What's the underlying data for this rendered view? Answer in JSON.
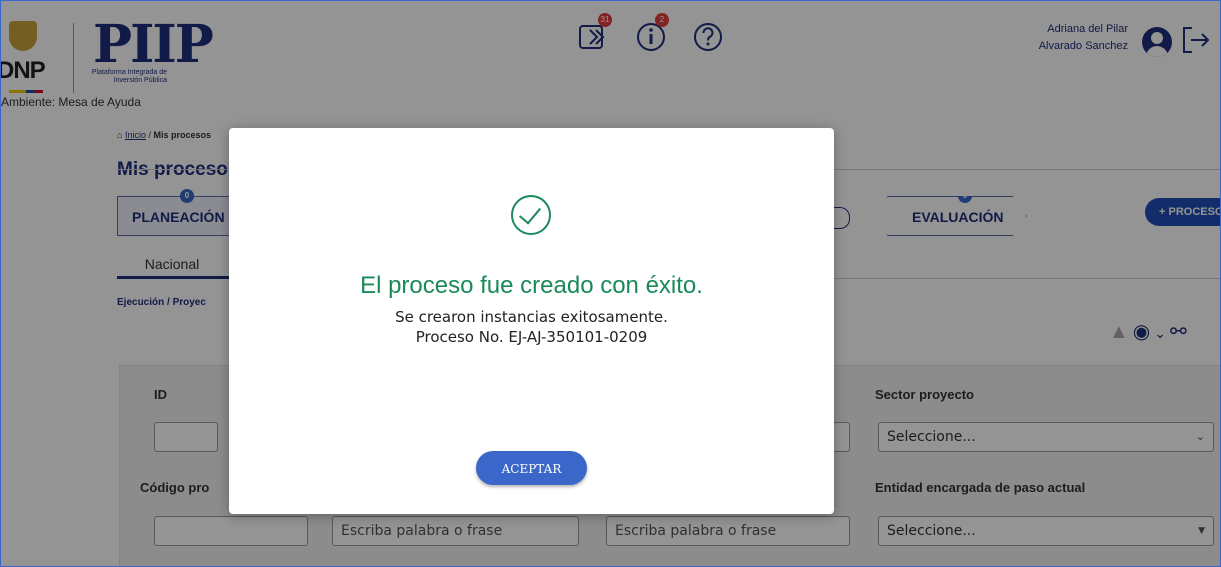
{
  "header": {
    "logo_dnp": "DNP",
    "logo_pip": "PIIP",
    "logo_pip_subtitle": "Plataforma Integrada de Inversión Pública",
    "ambiente": "Ambiente: Mesa de Ayuda",
    "icons": [
      {
        "name": "processes-icon",
        "badge": "31"
      },
      {
        "name": "info-icon",
        "badge": "2"
      },
      {
        "name": "help-icon",
        "badge": ""
      }
    ],
    "user_name_line1": "Adriana del Pilar",
    "user_name_line2": "Alvarado Sanchez"
  },
  "breadcrumb": {
    "home": "Inicio",
    "separator": " / ",
    "current": "Mis procesos"
  },
  "page_title": "Mis procesos",
  "stages": [
    {
      "label": "PLANEACIÓN",
      "count": "0"
    },
    {
      "label": "EVALUACIÓN",
      "count": "0"
    }
  ],
  "new_process_button": "+ PROCESO",
  "tabs": [
    {
      "label": "Nacional",
      "active": true
    }
  ],
  "sub_breadcrumb": "Ejecución / Proyec",
  "filters": {
    "id_label": "ID",
    "sector_label": "Sector proyecto",
    "sector_value": "Seleccione...",
    "codigo_label": "Código pro",
    "entidad_label": "Entidad encargada de paso actual",
    "entidad_value": "Seleccione...",
    "search_placeholder_1": "Escriba palabra o frase",
    "search_placeholder_2": "Escriba palabra o frase"
  },
  "modal": {
    "title": "El proceso fue creado con éxito.",
    "line1": "Se crearon instancias exitosamente.",
    "line2": "Proceso No. EJ-AJ-350101-0209",
    "accept_label": "ACEPTAR"
  },
  "colors": {
    "primary": "#1f2f7a",
    "accent": "#3a67c9",
    "success": "#1a8a5a"
  }
}
